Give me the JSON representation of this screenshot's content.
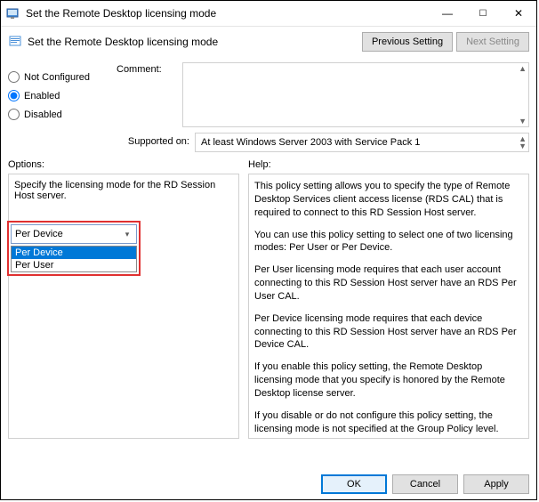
{
  "window": {
    "title": "Set the Remote Desktop licensing mode"
  },
  "header": {
    "title": "Set the Remote Desktop licensing mode",
    "previous": "Previous Setting",
    "next": "Next Setting"
  },
  "state": {
    "not_configured": "Not Configured",
    "enabled": "Enabled",
    "disabled": "Disabled",
    "selected": "enabled"
  },
  "comment": {
    "label": "Comment:",
    "value": ""
  },
  "supported": {
    "label": "Supported on:",
    "value": "At least Windows Server 2003 with Service Pack 1"
  },
  "labels": {
    "options": "Options:",
    "help": "Help:"
  },
  "options": {
    "specify": "Specify the licensing mode for the RD Session Host server.",
    "selected_value": "Per Device",
    "dropdown": [
      "Per Device",
      "Per User"
    ]
  },
  "help": {
    "p1": "This policy setting allows you to specify the type of Remote Desktop Services client access license (RDS CAL) that is required to connect to this RD Session Host server.",
    "p2": "You can use this policy setting to select one of two licensing modes: Per User or Per Device.",
    "p3": "Per User licensing mode requires that each user account connecting to this RD Session Host server have an RDS Per User CAL.",
    "p4": "Per Device licensing mode requires that each device connecting to this RD Session Host server have an RDS Per Device CAL.",
    "p5": "If you enable this policy setting, the Remote Desktop licensing mode that you specify is honored by the Remote Desktop license server.",
    "p6": "If you disable or do not configure this policy setting, the licensing mode is not specified at the Group Policy level."
  },
  "footer": {
    "ok": "OK",
    "cancel": "Cancel",
    "apply": "Apply"
  }
}
